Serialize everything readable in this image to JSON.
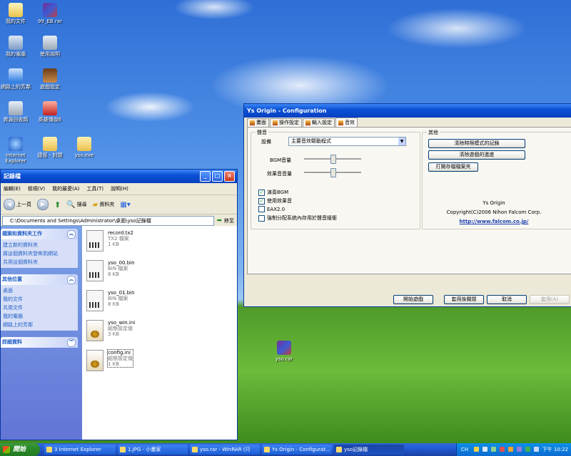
{
  "desktop": {
    "icons": [
      {
        "label": "我的文件",
        "name": "my-documents-icon"
      },
      {
        "label": "99_EB.rar",
        "name": "rar-archive-icon"
      },
      {
        "label": "我的電腦",
        "name": "my-computer-icon"
      },
      {
        "label": "使用說明",
        "name": "manual-icon"
      },
      {
        "label": "網路上的芳鄰",
        "name": "network-places-icon"
      },
      {
        "label": "遊戲設定",
        "name": "game-settings-icon"
      },
      {
        "label": "資源回收筒",
        "name": "recycle-bin-icon"
      },
      {
        "label": "英雄傳說6",
        "name": "eiyuu-densetsu-icon"
      },
      {
        "label": "Internet Explorer",
        "name": "internet-explorer-icon"
      },
      {
        "label": "捷徑 - 封閉",
        "name": "shortcut-folder-icon"
      },
      {
        "label": "yso.exe",
        "name": "yso-folder-icon"
      },
      {
        "label": "yso.rar",
        "name": "yso-rar-icon"
      }
    ]
  },
  "explorer": {
    "title": "記錄檔",
    "menu": [
      "編輯(E)",
      "檢視(V)",
      "我的最愛(A)",
      "工具(T)",
      "說明(H)"
    ],
    "toolbar": {
      "back": "上一頁",
      "search": "搜尋",
      "folders": "資料夾"
    },
    "address": "C:\\Documents and Settings\\Administrator\\桌面\\yso記錄檔",
    "go": "移至",
    "panels": [
      {
        "title": "檔案和資料夾工作",
        "items": [
          "建立新的資料夾",
          "將這個資料夾發佈到網站",
          "共用這個資料夾"
        ]
      },
      {
        "title": "其他位置",
        "items": [
          "桌面",
          "我的文件",
          "共用文件",
          "我的電腦",
          "網路上的芳鄰"
        ]
      },
      {
        "title": "詳細資料",
        "items": []
      }
    ],
    "files": [
      {
        "name": "record.tx2",
        "type": "TX2 檔案",
        "size": "1 KB",
        "kind": "bin"
      },
      {
        "name": "yso_00.bin",
        "type": "BIN 檔案",
        "size": "8 KB",
        "kind": "bin"
      },
      {
        "name": "yso_01.bin",
        "type": "BIN 檔案",
        "size": "8 KB",
        "kind": "bin"
      },
      {
        "name": "yso_win.ini",
        "type": "組態設定值",
        "size": "3 KB",
        "kind": "ini"
      },
      {
        "name": "config.ini",
        "type": "組態設定值",
        "size": "1 KB",
        "kind": "ini"
      }
    ]
  },
  "config": {
    "title": "Ys Origin - Configuration",
    "tabs": [
      "畫面",
      "操作設定",
      "輸入設定",
      "音效"
    ],
    "sound_group": "聲音",
    "device_label": "設備",
    "device_value": "主要音效驅動程式",
    "bgm_label": "BGM音量",
    "se_label": "效果音音量",
    "bgm_volume": 0.5,
    "se_volume": 0.5,
    "checks": [
      {
        "label": "演奏BGM",
        "checked": true
      },
      {
        "label": "使用效果音",
        "checked": true
      },
      {
        "label": "EAX2.0",
        "checked": false
      },
      {
        "label": "強制分配系統內存用於聲音緩衝",
        "checked": false
      }
    ],
    "other_group": "其他",
    "other_buttons": [
      "清除時限模式的記錄",
      "清除遊戲的進度",
      "打開存檔檔案夾"
    ],
    "about": {
      "product": "Ys Origin",
      "copyright": "Copyright(C)2006 Nihon Falcom Corp.",
      "url": "http://www.falcom.co.jp/"
    },
    "footer_buttons": [
      "開始遊戲",
      "套用後關閉",
      "取消",
      "套用(A)"
    ]
  },
  "taskbar": {
    "start": "開始",
    "items": [
      "3 Internet Explorer",
      "1.JPG - 小畫家",
      "yso.rar - WinRAR (只",
      "Ys Origin - Configurat...",
      "yso記錄檔"
    ],
    "tray_lang": "CH",
    "clock": "下午 10:22"
  }
}
